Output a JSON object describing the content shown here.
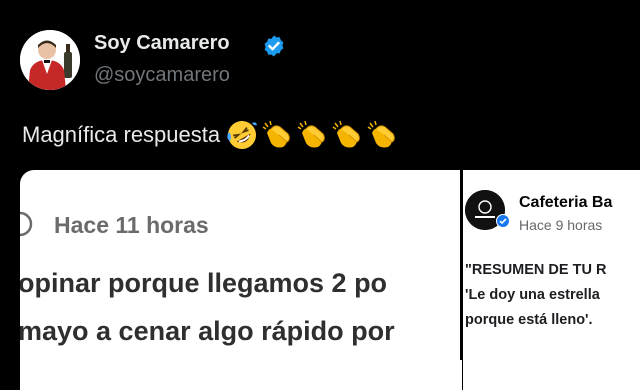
{
  "tweet": {
    "author_name": "Soy Camarero",
    "author_handle": "@soycamarero",
    "text": "Magnífica respuesta",
    "emojis": [
      "rolling-on-floor-laughing-emoji",
      "clapping-hands-emoji",
      "clapping-hands-emoji",
      "clapping-hands-emoji",
      "clapping-hands-emoji"
    ]
  },
  "left_card": {
    "time": "Hace 11 horas",
    "line1": "opinar porque llegamos 2 po",
    "line2": "mayo a cenar algo rápido por"
  },
  "right_card": {
    "page_name": "Cafeteria Ba",
    "time": "Hace 9 horas",
    "line1": "\"RESUMEN DE TU R",
    "line2": "'Le doy una estrella",
    "line3": "porque está lleno'."
  },
  "colors": {
    "background": "#000000",
    "verified": "#1d9bf0",
    "name_text": "#e7e9ea",
    "handle_text": "#71767b"
  }
}
